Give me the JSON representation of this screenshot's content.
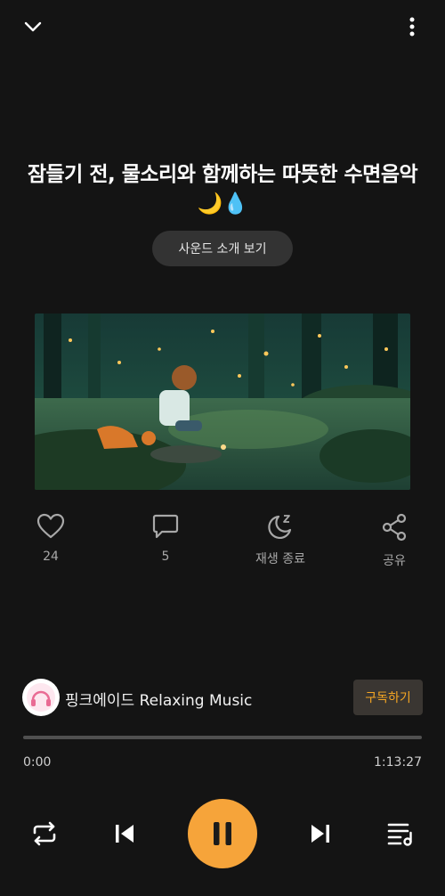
{
  "header": {
    "collapse_icon": "chevron-down-icon",
    "menu_icon": "more-vertical-icon"
  },
  "track": {
    "title": "잠들기 전, 물소리와 함께하는 따뜻한 수면음악 🌙💧",
    "intro_button": "사운드 소개 보기"
  },
  "actions": {
    "like": {
      "icon": "heart-icon",
      "label": "24"
    },
    "comment": {
      "icon": "comment-icon",
      "label": "5"
    },
    "sleep_timer": {
      "icon": "moon-zz-icon",
      "label": "재생 종료"
    },
    "share": {
      "icon": "share-icon",
      "label": "공유"
    }
  },
  "channel": {
    "avatar_icon": "headphones-logo",
    "name": "핑크에이드 Relaxing Music",
    "subscribe_label": "구독하기"
  },
  "player": {
    "current_time": "0:00",
    "total_time": "1:13:27",
    "progress": 0,
    "accent_color": "#f6a43a"
  },
  "controls": {
    "repeat_icon": "repeat-icon",
    "previous_icon": "skip-previous-icon",
    "pause_icon": "pause-icon",
    "next_icon": "skip-next-icon",
    "playlist_icon": "playlist-icon"
  }
}
